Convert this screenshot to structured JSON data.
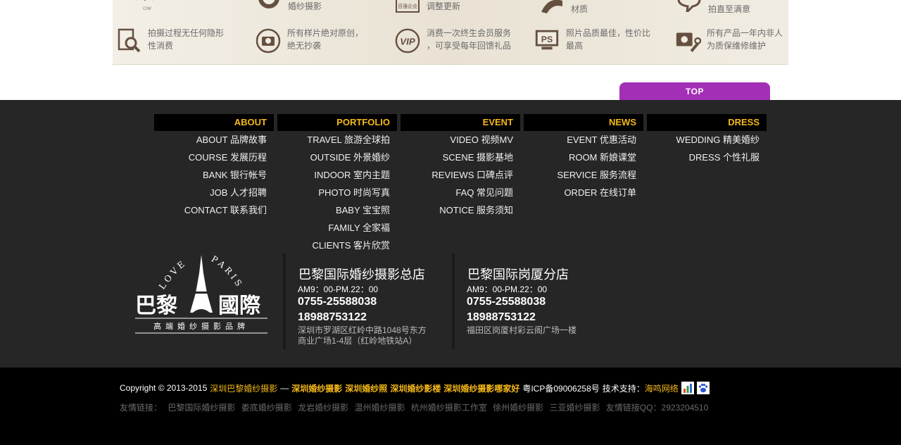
{
  "features": {
    "row1": [
      {
        "icon": "cw-logo-icon",
        "text": ""
      },
      {
        "icon": "award-medal-icon",
        "text": "婚纱摄影"
      },
      {
        "icon": "certified-enterprise-icon",
        "badge": "百强企业",
        "text": "调整更新"
      },
      {
        "icon": "material-icon",
        "text": "材质"
      },
      {
        "icon": "chat-bubble-icon",
        "text": "拍直至满意"
      }
    ],
    "row2": [
      {
        "icon": "search-document-icon",
        "lines": [
          "拍摄过程无任何隐形",
          "性消费"
        ]
      },
      {
        "icon": "camera-icon",
        "lines": [
          "所有样片绝对原创，",
          "绝无抄袭"
        ]
      },
      {
        "icon": "vip-icon",
        "badge": "VIP",
        "lines": [
          "消费一次终生会员服务",
          "，可享受每年回馈礼品"
        ]
      },
      {
        "icon": "ps-icon",
        "badge": "PS",
        "lines": [
          "照片品质最佳，性价比",
          "最高"
        ]
      },
      {
        "icon": "camera-wrench-icon",
        "lines": [
          "所有产品一年内非人",
          "为质保维修维护"
        ]
      }
    ]
  },
  "top_button": "TOP",
  "nav": [
    {
      "heading": "ABOUT",
      "links": [
        "ABOUT 品牌故事",
        "COURSE 发展历程",
        "BANK 银行帐号",
        "JOB 人才招聘",
        "CONTACT 联系我们"
      ]
    },
    {
      "heading": "PORTFOLIO",
      "links": [
        "TRAVEL 旅游全球拍",
        "OUTSIDE 外景婚纱",
        "INDOOR 室内主题",
        "PHOTO 时尚写真",
        "BABY 宝宝照",
        "FAMILY 全家福",
        "CLIENTS 客片欣赏"
      ]
    },
    {
      "heading": "EVENT",
      "links": [
        "VIDEO 视频MV",
        "SCENE 摄影基地",
        "REVIEWS 口碑点评",
        "FAQ 常见问题",
        "NOTICE 服务须知"
      ]
    },
    {
      "heading": "NEWS",
      "links": [
        "EVENT 优惠活动",
        "ROOM 新娘课堂",
        "SERVICE 服务流程",
        "ORDER 在线订单"
      ]
    },
    {
      "heading": "DRESS",
      "links": [
        "WEDDING 精美婚纱",
        "DRESS 个性礼服"
      ]
    }
  ],
  "logo": {
    "arc_left": "LOVE",
    "arc_right": "PARIS",
    "name_left": "巴黎",
    "name_right": "國際",
    "tagline": "高端婚纱摄影品牌"
  },
  "stores": [
    {
      "name": "巴黎国际婚纱摄影总店",
      "hours": "AM9：00-PM.22：00",
      "phone1": "0755-25588038",
      "phone2": "18988753122",
      "address1": "深圳市罗湖区红岭中路1048号东方",
      "address2": "商业广场1-4层（红岭地铁站A）"
    },
    {
      "name": "巴黎国际岗厦分店",
      "hours": "AM9：00-PM.22：00",
      "phone1": "0755-25588038",
      "phone2": "18988753122",
      "address1": "福田区岗厦村彩云阁广场一楼",
      "address2": ""
    }
  ],
  "copyright": {
    "prefix": "Copyright © 2013-2015",
    "site": "深圳巴黎婚纱摄影",
    "dash": "—",
    "keywords": [
      "深圳婚纱摄影",
      "深圳婚纱照",
      "深圳婚纱影楼",
      "深圳婚纱摄影哪家好"
    ],
    "icp": "粤ICP备09006258号",
    "tech_label": "技术支持：",
    "tech_value": "海鸣网络"
  },
  "friend_links": {
    "label": "友情链接：",
    "items": [
      "巴黎国际婚纱摄影",
      "娄底婚纱摄影",
      "龙岩婚纱摄影",
      "温州婚纱摄影",
      "杭州婚纱摄影工作室",
      "徐州婚纱摄影",
      "三亚婚纱摄影",
      "友情链接QQ：2923204510"
    ]
  },
  "colors": {
    "accent": "#f5b917",
    "top_button": "#a42fb7",
    "footer_bg": "#262626",
    "bottom_bg": "#000000"
  }
}
